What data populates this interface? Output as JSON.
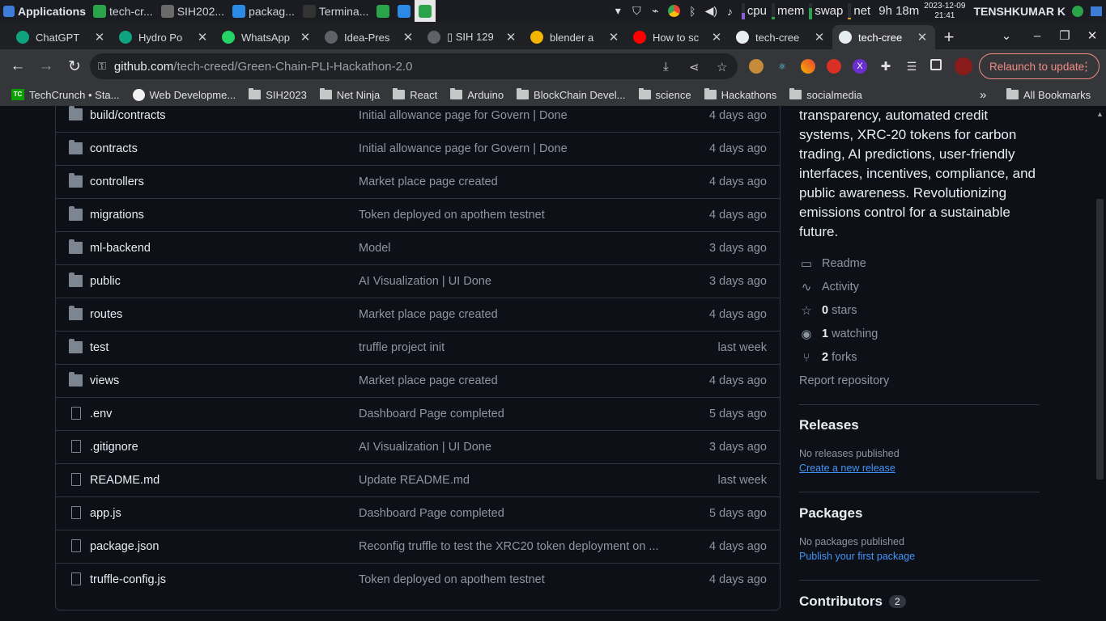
{
  "taskbar": {
    "menu_label": "Applications",
    "tasks": [
      {
        "label": "tech-cr...",
        "color": "#2aa34a"
      },
      {
        "label": "SIH202...",
        "color": "#6a6a6a"
      },
      {
        "label": "packag...",
        "color": "#2b8ae6"
      },
      {
        "label": "Termina...",
        "color": "#333333"
      },
      {
        "label": "",
        "color": "#2aa34a"
      },
      {
        "label": "",
        "color": "#2b8ae6"
      },
      {
        "label": "",
        "color": "#2aa34a",
        "active": true
      }
    ],
    "monitors": {
      "cpu": "cpu",
      "mem": "mem",
      "swap": "swap",
      "net": "net"
    },
    "battery": "9h 18m",
    "date": "2023-12-09",
    "time": "21:41",
    "user": "TENSHKUMAR K"
  },
  "tabs": [
    {
      "label": "ChatGPT",
      "icon": "chatgpt-icon",
      "color": "#10a37f"
    },
    {
      "label": "Hydro Po",
      "icon": "chatgpt-icon",
      "color": "#10a37f"
    },
    {
      "label": "WhatsApp",
      "icon": "whatsapp-icon",
      "color": "#25d366"
    },
    {
      "label": "Idea-Pres",
      "icon": "globe-icon",
      "color": "#5f6368"
    },
    {
      "label": "▯ SIH 129",
      "icon": "globe-icon",
      "color": "#5f6368"
    },
    {
      "label": "blender a",
      "icon": "drive-icon",
      "color": "#f4b400"
    },
    {
      "label": "How to sc",
      "icon": "youtube-icon",
      "color": "#ff0000"
    },
    {
      "label": "tech-cree",
      "icon": "github-icon",
      "color": "#e6edf3"
    },
    {
      "label": "tech-cree",
      "icon": "github-icon",
      "color": "#e6edf3",
      "active": true
    }
  ],
  "address": {
    "host": "github.com",
    "path": "/tech-creed/Green-Chain-PLI-Hackathon-2.0"
  },
  "relaunch_label": "Relaunch to update",
  "bookmarks": [
    {
      "label": "TechCrunch • Sta...",
      "type": "tc"
    },
    {
      "label": "Web Developme...",
      "type": "web"
    },
    {
      "label": "SIH2023",
      "type": "folder"
    },
    {
      "label": "Net Ninja",
      "type": "folder"
    },
    {
      "label": "React",
      "type": "folder"
    },
    {
      "label": "Arduino",
      "type": "folder"
    },
    {
      "label": "BlockChain Devel...",
      "type": "folder"
    },
    {
      "label": "science",
      "type": "folder"
    },
    {
      "label": "Hackathons",
      "type": "folder"
    },
    {
      "label": "socialmedia",
      "type": "folder"
    }
  ],
  "all_bookmarks": "All Bookmarks",
  "files": [
    {
      "name": "build/contracts",
      "type": "dir",
      "message": "Initial allowance page for Govern | Done",
      "date": "4 days ago"
    },
    {
      "name": "contracts",
      "type": "dir",
      "message": "Initial allowance page for Govern | Done",
      "date": "4 days ago"
    },
    {
      "name": "controllers",
      "type": "dir",
      "message": "Market place page created",
      "date": "4 days ago"
    },
    {
      "name": "migrations",
      "type": "dir",
      "message": "Token deployed on apothem testnet",
      "date": "4 days ago"
    },
    {
      "name": "ml-backend",
      "type": "dir",
      "message": "Model",
      "date": "3 days ago"
    },
    {
      "name": "public",
      "type": "dir",
      "message": "AI Visualization | UI Done",
      "date": "3 days ago"
    },
    {
      "name": "routes",
      "type": "dir",
      "message": "Market place page created",
      "date": "4 days ago"
    },
    {
      "name": "test",
      "type": "dir",
      "message": "truffle project init",
      "date": "last week"
    },
    {
      "name": "views",
      "type": "dir",
      "message": "Market place page created",
      "date": "4 days ago"
    },
    {
      "name": ".env",
      "type": "file",
      "message": "Dashboard Page completed",
      "date": "5 days ago"
    },
    {
      "name": ".gitignore",
      "type": "file",
      "message": "AI Visualization | UI Done",
      "date": "3 days ago"
    },
    {
      "name": "README.md",
      "type": "file",
      "message": "Update README.md",
      "date": "last week"
    },
    {
      "name": "app.js",
      "type": "file",
      "message": "Dashboard Page completed",
      "date": "5 days ago"
    },
    {
      "name": "package.json",
      "type": "file",
      "message": "Reconfig truffle to test the XRC20 token deployment on ...",
      "date": "4 days ago"
    },
    {
      "name": "truffle-config.js",
      "type": "file",
      "message": "Token deployed on apothem testnet",
      "date": "4 days ago"
    }
  ],
  "sidebar": {
    "about_lines": [
      "transparency, automated credit",
      "systems, XRC-20 tokens for carbon",
      "trading, AI predictions, user-friendly",
      "interfaces, incentives, compliance, and",
      "public awareness. Revolutionizing",
      "emissions control for a sustainable",
      "future."
    ],
    "readme": "Readme",
    "activity": "Activity",
    "stars_count": "0",
    "stars_label": "stars",
    "watching_count": "1",
    "watching_label": "watching",
    "forks_count": "2",
    "forks_label": "forks",
    "report": "Report repository",
    "releases_title": "Releases",
    "releases_none": "No releases published",
    "releases_link": "Create a new release",
    "packages_title": "Packages",
    "packages_none": "No packages published",
    "packages_link": "Publish your first package",
    "contributors_title": "Contributors",
    "contributors_count": "2"
  }
}
